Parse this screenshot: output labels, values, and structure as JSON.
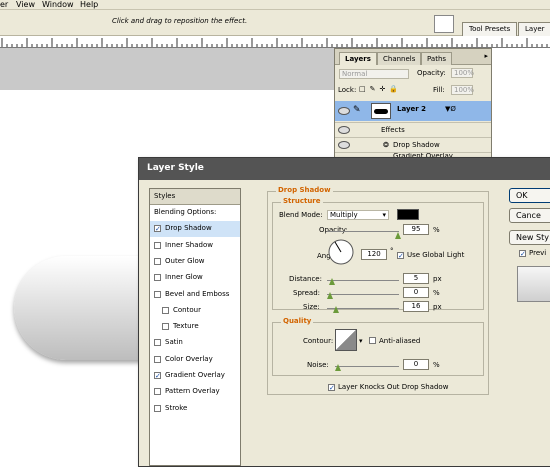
{
  "menu": {
    "items": [
      "er",
      "View",
      "Window",
      "Help"
    ]
  },
  "options_bar": {
    "hint": "Click and drag to reposition the effect."
  },
  "palette_well": {
    "tabs": [
      "Tool Presets",
      "Layer C"
    ]
  },
  "layers_panel": {
    "tabs": [
      "Layers",
      "Channels",
      "Paths"
    ],
    "blend_mode": "Normal",
    "opacity_label": "Opacity:",
    "opacity_value": "100%",
    "lock_label": "Lock:",
    "fill_label": "Fill:",
    "fill_value": "100%",
    "layer_name": "Layer 2",
    "effects_label": "Effects",
    "effect_1": "Drop Shadow",
    "effect_2": "Gradient Overlay"
  },
  "dialog": {
    "title": "Layer Style",
    "styles_header": "Styles",
    "items": [
      {
        "label": "Blending Options: Default",
        "checkbox": false,
        "checked": false,
        "indent": false
      },
      {
        "label": "Drop Shadow",
        "checkbox": true,
        "checked": true,
        "indent": false,
        "selected": true
      },
      {
        "label": "Inner Shadow",
        "checkbox": true,
        "checked": false,
        "indent": false
      },
      {
        "label": "Outer Glow",
        "checkbox": true,
        "checked": false,
        "indent": false
      },
      {
        "label": "Inner Glow",
        "checkbox": true,
        "checked": false,
        "indent": false
      },
      {
        "label": "Bevel and Emboss",
        "checkbox": true,
        "checked": false,
        "indent": false
      },
      {
        "label": "Contour",
        "checkbox": true,
        "checked": false,
        "indent": true
      },
      {
        "label": "Texture",
        "checkbox": true,
        "checked": false,
        "indent": true
      },
      {
        "label": "Satin",
        "checkbox": true,
        "checked": false,
        "indent": false
      },
      {
        "label": "Color Overlay",
        "checkbox": true,
        "checked": false,
        "indent": false
      },
      {
        "label": "Gradient Overlay",
        "checkbox": true,
        "checked": true,
        "indent": false
      },
      {
        "label": "Pattern Overlay",
        "checkbox": true,
        "checked": false,
        "indent": false
      },
      {
        "label": "Stroke",
        "checkbox": true,
        "checked": false,
        "indent": false
      }
    ],
    "section_title": "Drop Shadow",
    "structure_title": "Structure",
    "blend_mode_label": "Blend Mode:",
    "blend_mode_value": "Multiply",
    "shadow_color": "#000000",
    "opacity_label": "Opacity:",
    "opacity_value": "95",
    "angle_label": "Angle:",
    "angle_value": "120",
    "degree_symbol": "°",
    "use_global_light_label": "Use Global Light",
    "use_global_light_checked": true,
    "distance_label": "Distance:",
    "distance_value": "5",
    "spread_label": "Spread:",
    "spread_value": "0",
    "size_label": "Size:",
    "size_value": "16",
    "px": "px",
    "percent": "%",
    "quality_title": "Quality",
    "contour_label": "Contour:",
    "anti_aliased_label": "Anti-aliased",
    "anti_aliased_checked": false,
    "noise_label": "Noise:",
    "noise_value": "0",
    "knockout_label": "Layer Knocks Out Drop Shadow",
    "knockout_checked": true,
    "buttons": {
      "ok": "OK",
      "cancel": "Cance",
      "new_style": "New Sty",
      "preview": "Previ"
    },
    "preview_checked": true
  },
  "colors": {
    "accent_title": "#d26400",
    "selection": "#cfe3f7",
    "layer_selected": "#8fb7e8"
  }
}
